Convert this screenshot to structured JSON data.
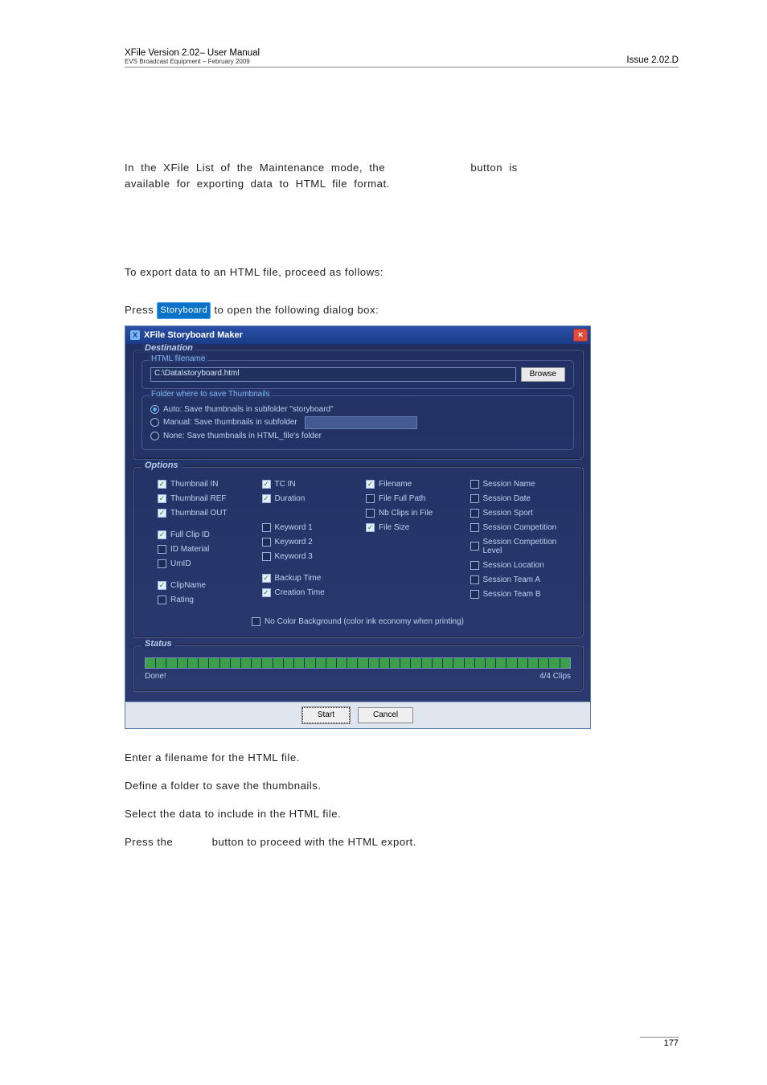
{
  "header": {
    "left_line1": "XFile Version 2.02– User Manual",
    "left_line2": "EVS Broadcast Equipment – February 2009",
    "right": "Issue 2.02.D"
  },
  "intro": {
    "line1_a": "In  the  XFile  List  of  the  Maintenance  mode,  the",
    "line1_b": "button  is",
    "line2": "available for exporting data to HTML file format."
  },
  "howto_intro": "To export data to an HTML file, proceed as follows:",
  "step1_a": "Press ",
  "step1_badge": "Storyboard",
  "step1_b": " to open the following dialog box:",
  "dialog": {
    "title": "XFile Storyboard Maker",
    "close": "×",
    "destination": {
      "title": "Destination",
      "html_filename_label": "HTML filename",
      "path": "C:\\Data\\storyboard.html",
      "browse": "Browse",
      "thumb_folder_label": "Folder where to save Thumbnails",
      "r_auto": "Auto: Save thumbnails in subfolder \"storyboard\"",
      "r_manual": "Manual: Save thumbnails in subfolder",
      "r_none": "None: Save thumbnails in HTML_file's folder"
    },
    "options": {
      "title": "Options",
      "col1": {
        "thumb_in": "Thumbnail IN",
        "thumb_ref": "Thumbnail REF",
        "thumb_out": "Thumbnail OUT",
        "full_clip_id": "Full Clip ID",
        "id_material": "ID Material",
        "umid": "UmID",
        "clipname": "ClipName",
        "rating": "Rating"
      },
      "col2": {
        "tc_in": "TC IN",
        "duration": "Duration",
        "kw1": "Keyword 1",
        "kw2": "Keyword 2",
        "kw3": "Keyword 3",
        "backup_time": "Backup Time",
        "creation_time": "Creation Time"
      },
      "col3": {
        "filename": "Filename",
        "file_full_path": "File Full Path",
        "nb_clips": "Nb Clips in File",
        "file_size": "File Size"
      },
      "col4": {
        "s_name": "Session Name",
        "s_date": "Session Date",
        "s_sport": "Session Sport",
        "s_comp": "Session Competition",
        "s_comp_lvl": "Session Competition Level",
        "s_loc": "Session Location",
        "s_team_a": "Session Team A",
        "s_team_b": "Session Team B"
      },
      "economy": "No Color Background (color ink economy when printing)"
    },
    "status": {
      "title": "Status",
      "done": "Done!",
      "clips": "4/4 Clips"
    },
    "footer": {
      "start": "Start",
      "cancel": "Cancel"
    }
  },
  "after": {
    "l1": "Enter a filename for the HTML file.",
    "l2": "Define a folder to save the thumbnails.",
    "l3": "Select the data to include in the HTML file.",
    "l4_a": "Press the",
    "l4_b": "button to proceed with the HTML export."
  },
  "footer_page": "177"
}
